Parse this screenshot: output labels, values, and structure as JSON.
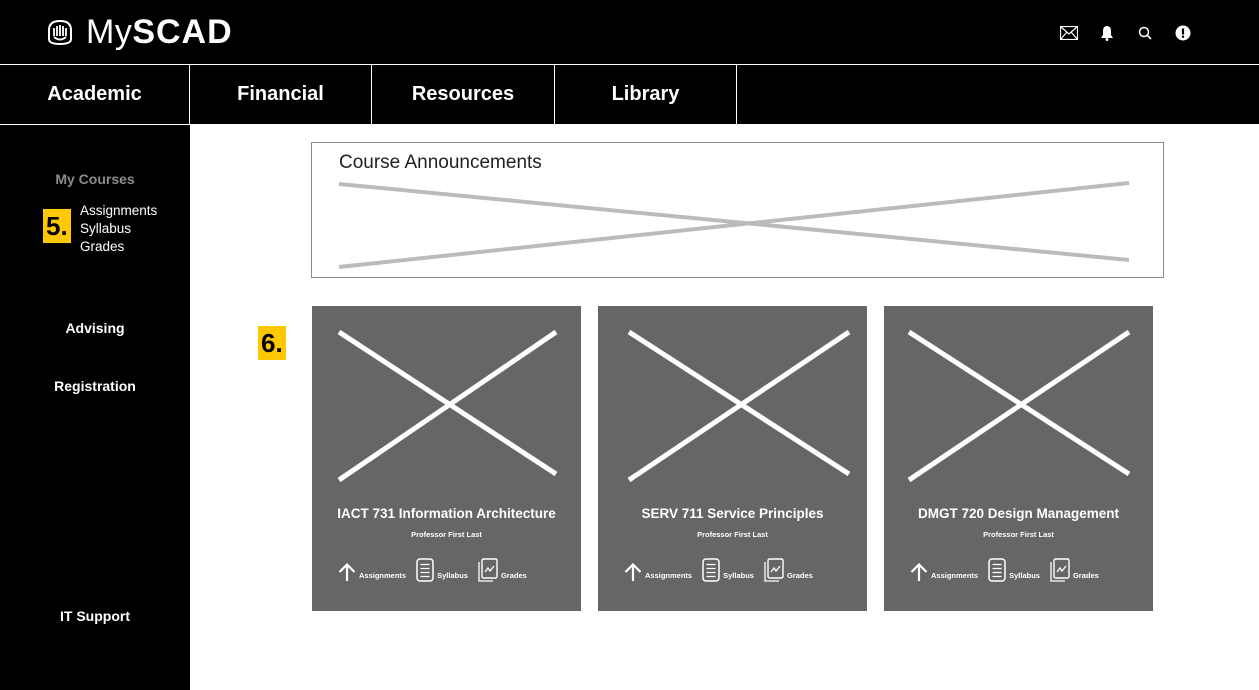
{
  "header": {
    "logo": {
      "prefix": "My",
      "bold": "SCAD"
    },
    "icons": [
      "mail-icon",
      "bell-icon",
      "search-icon",
      "alert-icon"
    ]
  },
  "nav": {
    "tabs": [
      {
        "label": "Academic"
      },
      {
        "label": "Financial"
      },
      {
        "label": "Resources"
      },
      {
        "label": "Library"
      }
    ]
  },
  "sidebar": {
    "my_courses": "My Courses",
    "sub_items": [
      "Assignments",
      "Syllabus",
      "Grades"
    ],
    "advising": "Advising",
    "registration": "Registration",
    "it_support": "IT Support"
  },
  "callouts": {
    "five": "5.",
    "six": "6."
  },
  "announcements": {
    "title": "Course Announcements"
  },
  "courses": [
    {
      "title": "IACT 731 Information Architecture",
      "professor": "Professor First Last",
      "links": [
        "Assignments",
        "Syllabus",
        "Grades"
      ]
    },
    {
      "title": "SERV 711 Service Principles",
      "professor": "Professor First Last",
      "links": [
        "Assignments",
        "Syllabus",
        "Grades"
      ]
    },
    {
      "title": "DMGT 720 Design Management",
      "professor": "Professor First Last",
      "links": [
        "Assignments",
        "Syllabus",
        "Grades"
      ]
    }
  ],
  "colors": {
    "header_bg": "#000000",
    "card_bg": "#666666",
    "callout": "#ffc800",
    "placeholder_line": "#bbbbbb"
  }
}
